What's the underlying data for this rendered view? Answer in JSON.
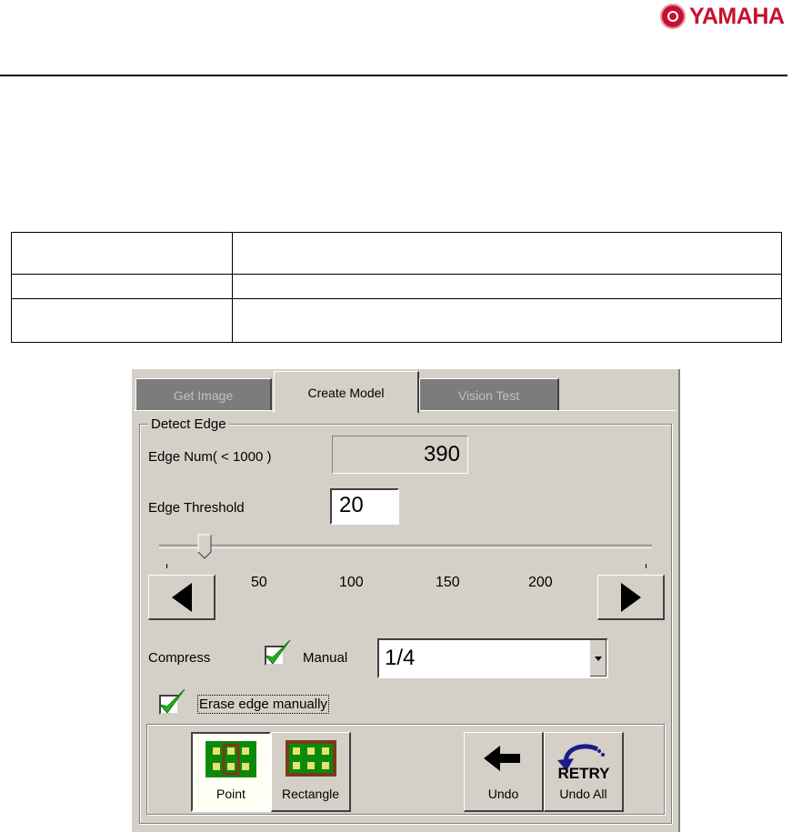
{
  "header": {
    "logo_text": "YAMAHA",
    "logo_icon": "tuning-fork-emblem-icon",
    "brand_color": "#c8102e"
  },
  "tabs": [
    {
      "label": "Get Image",
      "active": false
    },
    {
      "label": "Create Model",
      "active": true
    },
    {
      "label": "Vision Test",
      "active": false
    }
  ],
  "detect_edge": {
    "title": "Detect Edge",
    "edge_num_label": "Edge Num( < 1000 )",
    "edge_num_value": "390",
    "threshold_label": "Edge Threshold",
    "threshold_value": "20",
    "slider_value": 20,
    "scale_labels": [
      "50",
      "100",
      "150",
      "200"
    ]
  },
  "compress": {
    "label": "Compress",
    "manual_label": "Manual",
    "manual_checked": true,
    "ratio_value": "1/4"
  },
  "erase": {
    "label": "Erase edge manually",
    "checked": true
  },
  "tools": {
    "point_label": "Point",
    "rectangle_label": "Rectangle",
    "undo_label": "Undo",
    "undo_all_label": "Undo All",
    "retry_text": "RETRY"
  },
  "colors": {
    "check_green": "#22b222",
    "pcb_green": "#0a8a0a",
    "pcb_brown": "#7a3a1a",
    "pad_yellow": "#e8e070",
    "retry_blue": "#1a1a8a"
  }
}
